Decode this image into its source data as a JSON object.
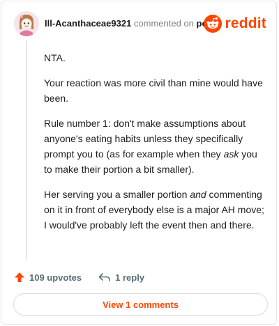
{
  "header": {
    "username": "Ill-Acanthaceae9321",
    "commented_on": "commented on",
    "post_link": "post",
    "brand": "reddit"
  },
  "comment": {
    "paragraphs": [
      {
        "text": "NTA."
      },
      {
        "text": "Your reaction was more civil than mine would have been."
      },
      {
        "before": "Rule number 1: don't make assumptions about anyone's eating habits unless they specifically prompt you to (as for example when they ",
        "em": "ask",
        "after": " you to make their portion a bit smaller)."
      },
      {
        "before": "Her serving you a smaller portion ",
        "em": "and",
        "after": " commenting on it in front of everybody else is a major AH move; I would've probably left the event then and there."
      }
    ]
  },
  "actions": {
    "upvotes": "109 upvotes",
    "replies": "1 reply"
  },
  "footer": {
    "view_comments": "View 1 comments"
  },
  "colors": {
    "brand": "#ff4500",
    "muted": "#576f76",
    "text": "#1c1c1c"
  }
}
